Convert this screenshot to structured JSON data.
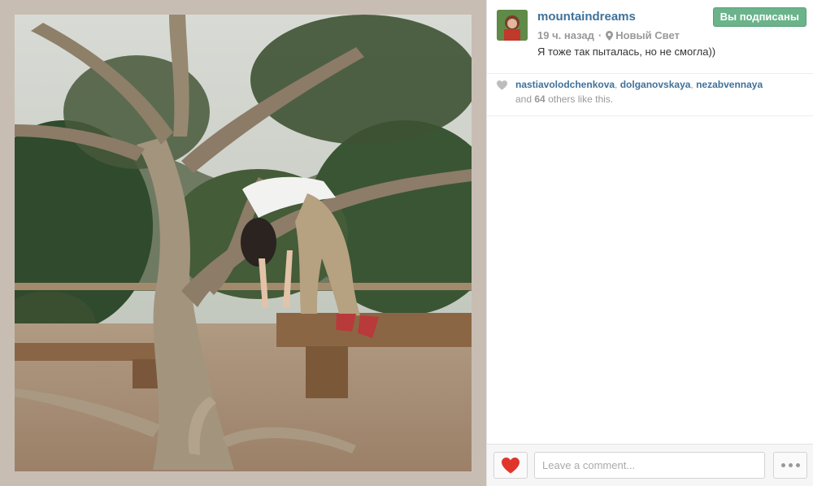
{
  "post": {
    "username": "mountaindreams",
    "follow_label": "Вы подписаны",
    "time_ago": "19 ч. назад",
    "location": "Новый Свет",
    "caption": "Я тоже так пыталась, но не смогла))"
  },
  "likes": {
    "users": [
      "nastiavolodchenkova",
      "dolganovskaya",
      "nezabvennaya"
    ],
    "others_prefix": "and",
    "others_count": "64",
    "others_suffix": "others like this."
  },
  "footer": {
    "comment_placeholder": "Leave a comment..."
  },
  "icons": {
    "heart_icon": "heart",
    "pin_icon": "location-pin",
    "more_icon": "ellipsis"
  },
  "colors": {
    "link": "#3f729b",
    "follow_button": "#6bb38a",
    "heart_red": "#e0352b",
    "meta_grey": "#999999"
  }
}
